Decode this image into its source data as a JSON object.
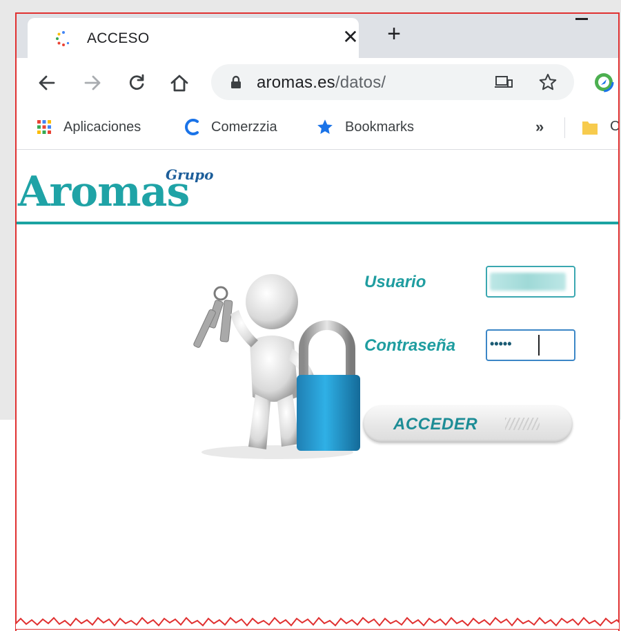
{
  "browser": {
    "tab": {
      "title": "ACCESO",
      "close_glyph": "✕"
    },
    "newtab_glyph": "+",
    "address_bar": {
      "host": "aromas.es",
      "path": "/datos/"
    },
    "bookmarks": [
      {
        "label": "Aplicaciones",
        "icon": "apps-grid-icon"
      },
      {
        "label": "Comerzzia",
        "icon": "comerzzia-c-icon"
      },
      {
        "label": "Bookmarks",
        "icon": "star-icon"
      }
    ],
    "overflow_glyph": "»",
    "folder_label": "C"
  },
  "page": {
    "logo": {
      "main": "Aromas",
      "tag": "Grupo"
    },
    "form": {
      "username_label": "Usuario",
      "password_label": "Contraseña",
      "password_mask": "•••••",
      "submit_label": "ACCEDER"
    }
  },
  "colors": {
    "brand_teal": "#1ba3a2",
    "focus_border": "#3b86c6",
    "window_border": "#e03030",
    "padlock_blue": "#2a9ed6"
  }
}
